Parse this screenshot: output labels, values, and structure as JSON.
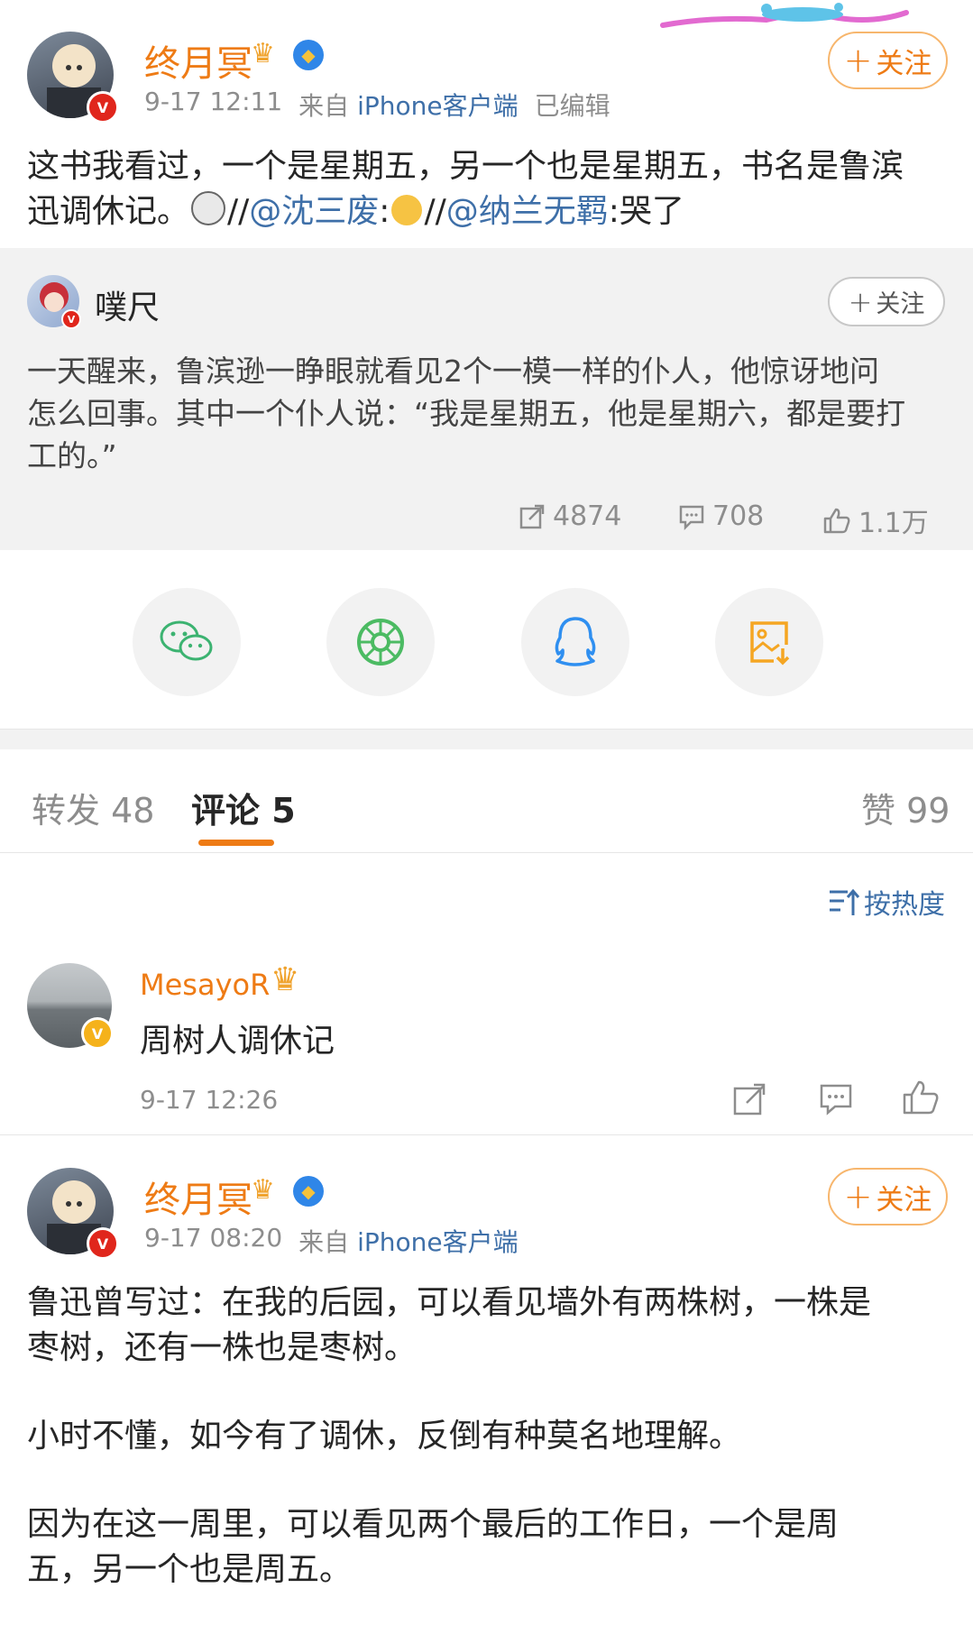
{
  "post": {
    "author": "终月冥",
    "time": "9-17 12:11",
    "source_prefix": "来自",
    "source": "iPhone客户端",
    "edited": "已编辑",
    "follow_label": "关注",
    "text_part1": "这书我看过，一个是星期五，另一个也是星期五，书名是鲁滨迅调休记。",
    "repost_sep1": "//",
    "mention1": "@沈三废",
    "colon1": ":",
    "repost_sep2": "//",
    "mention2": "@纳兰无羁",
    "text_tail": ":哭了"
  },
  "original": {
    "author": "噗尺",
    "follow_label": "关注",
    "text_line1": "一天醒来，鲁滨逊一睁眼就看见2个一模一样的仆人，他惊讶地问",
    "text_line2": "怎么回事。其中一个仆人说：“我是星期五，他是星期六，都是要打",
    "text_line3": "工的。”",
    "reposts": "4874",
    "comments": "708",
    "likes": "1.1万"
  },
  "share": {
    "icons": [
      "wechat-icon",
      "moments-icon",
      "qq-icon",
      "save-image-icon"
    ]
  },
  "tabs": {
    "repost": "转发 48",
    "comment": "评论 5",
    "like": "赞 99"
  },
  "sort": {
    "label": "按热度"
  },
  "comment1": {
    "author": "MesayoR",
    "text": "周树人调休记",
    "time": "9-17 12:26"
  },
  "comment2": {
    "author": "终月冥",
    "time": "9-17 08:20",
    "source_prefix": "来自",
    "source": "iPhone客户端",
    "follow_label": "关注",
    "p1_line1": "鲁迅曾写过：在我的后园，可以看见墙外有两株树，一株是",
    "p1_line2": "枣树，还有一株也是枣树。",
    "p2": "小时不懂，如今有了调休，反倒有种莫名地理解。",
    "p3_line1": "因为在这一周里，可以看见两个最后的工作日，一个是周",
    "p3_line2": "五，另一个也是周五。"
  },
  "colors": {
    "accent_orange": "#ee7b15",
    "link_blue": "#3e6fa8",
    "gray_text": "#8d8d8d",
    "quote_bg": "#f2f2f2",
    "badge_red": "#e0261c",
    "badge_yellow": "#f5b21b"
  }
}
